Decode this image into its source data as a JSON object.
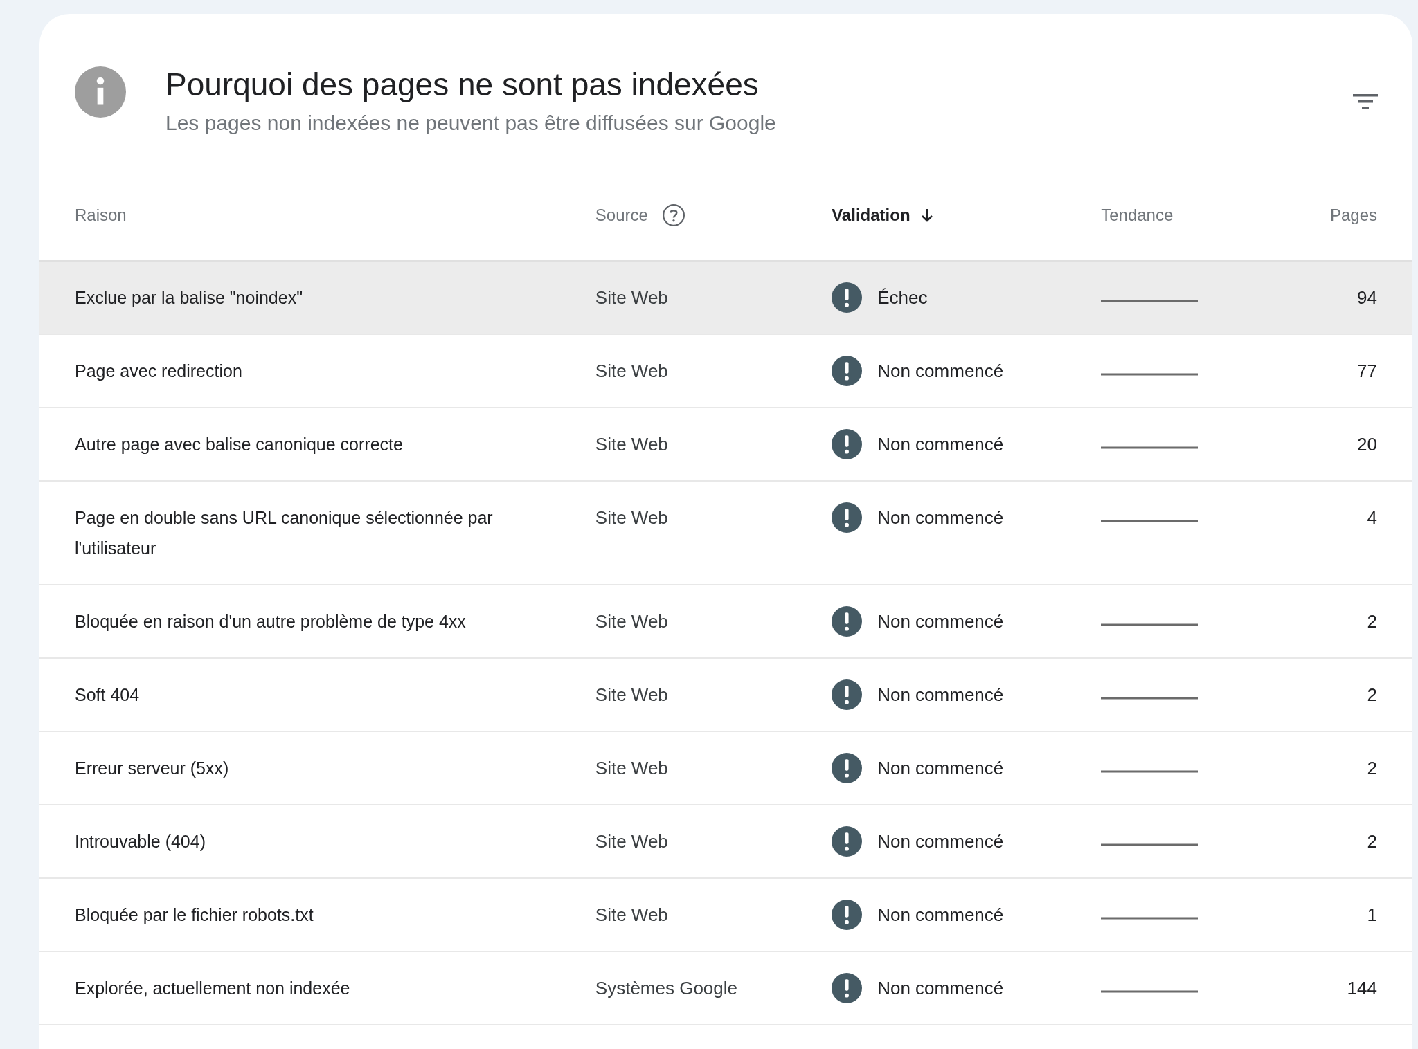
{
  "header": {
    "title": "Pourquoi des pages ne sont pas indexées",
    "subtitle": "Les pages non indexées ne peuvent pas être diffusées sur Google"
  },
  "table": {
    "columns": [
      {
        "label": "Raison",
        "sorted": false,
        "help": false
      },
      {
        "label": "Source",
        "sorted": false,
        "help": true
      },
      {
        "label": "Validation",
        "sorted": true,
        "help": false
      },
      {
        "label": "Tendance",
        "sorted": false,
        "help": false
      },
      {
        "label": "Pages",
        "sorted": false,
        "help": false
      }
    ],
    "rows": [
      {
        "reason": "Exclue par la balise \"noindex\"",
        "source": "Site Web",
        "validation": "Échec",
        "pages": "94",
        "selected": true
      },
      {
        "reason": "Page avec redirection",
        "source": "Site Web",
        "validation": "Non commencé",
        "pages": "77",
        "selected": false
      },
      {
        "reason": "Autre page avec balise canonique correcte",
        "source": "Site Web",
        "validation": "Non commencé",
        "pages": "20",
        "selected": false
      },
      {
        "reason": "Page en double sans URL canonique sélectionnée par l'utilisateur",
        "source": "Site Web",
        "validation": "Non commencé",
        "pages": "4",
        "selected": false
      },
      {
        "reason": "Bloquée en raison d'un autre problème de type 4xx",
        "source": "Site Web",
        "validation": "Non commencé",
        "pages": "2",
        "selected": false
      },
      {
        "reason": "Soft 404",
        "source": "Site Web",
        "validation": "Non commencé",
        "pages": "2",
        "selected": false
      },
      {
        "reason": "Erreur serveur (5xx)",
        "source": "Site Web",
        "validation": "Non commencé",
        "pages": "2",
        "selected": false
      },
      {
        "reason": "Introuvable (404)",
        "source": "Site Web",
        "validation": "Non commencé",
        "pages": "2",
        "selected": false
      },
      {
        "reason": "Bloquée par le fichier robots.txt",
        "source": "Site Web",
        "validation": "Non commencé",
        "pages": "1",
        "selected": false
      },
      {
        "reason": "Explorée, actuellement non indexée",
        "source": "Systèmes Google",
        "validation": "Non commencé",
        "pages": "144",
        "selected": false
      }
    ]
  }
}
